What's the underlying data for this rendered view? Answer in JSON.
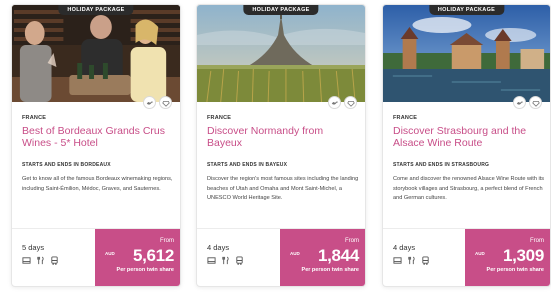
{
  "colors": {
    "accent": "#c84e88",
    "tag_bg": "#2b2b2b"
  },
  "cards": [
    {
      "tag": "HOLIDAY PACKAGE",
      "country": "FRANCE",
      "title": "Best of Bordeaux Grands Crus Wines - 5* Hotel",
      "starts_prefix": "STARTS AND ENDS IN",
      "starts_city": "BORDEAUX",
      "description": "Get to know all of the famous Bordeaux winemaking regions, including Saint-Émilion, Médoc, Graves, and Sauternes.",
      "days": "5 days",
      "from": "From",
      "currency": "AUD",
      "price": "5,612",
      "price_note": "Per person twin share",
      "icons": [
        "bird-icon",
        "diamond-icon"
      ],
      "amenities": [
        "bed-icon",
        "meal-icon",
        "transport-icon"
      ]
    },
    {
      "tag": "HOLIDAY PACKAGE",
      "country": "FRANCE",
      "title": "Discover Normandy from Bayeux",
      "starts_prefix": "STARTS AND ENDS IN",
      "starts_city": "BAYEUX",
      "description": "Discover the region's most famous sites including the landing beaches of Utah and Omaha and Mont Saint-Michel, a UNESCO World Heritage Site.",
      "days": "4 days",
      "from": "From",
      "currency": "AUD",
      "price": "1,844",
      "price_note": "Per person twin share",
      "icons": [
        "bird-icon",
        "diamond-icon"
      ],
      "amenities": [
        "bed-icon",
        "meal-icon",
        "transport-icon"
      ]
    },
    {
      "tag": "HOLIDAY PACKAGE",
      "country": "FRANCE",
      "title": "Discover Strasbourg and the Alsace Wine Route",
      "starts_prefix": "STARTS AND ENDS IN",
      "starts_city": "STRASBOURG",
      "description": "Come and discover the renowned Alsace Wine Route with its storybook villages and Strasbourg, a perfect blend of French and German cultures.",
      "days": "4 days",
      "from": "From",
      "currency": "AUD",
      "price": "1,309",
      "price_note": "Per person twin share",
      "icons": [
        "bird-icon",
        "diamond-icon"
      ],
      "amenities": [
        "bed-icon",
        "meal-icon",
        "transport-icon"
      ]
    }
  ]
}
